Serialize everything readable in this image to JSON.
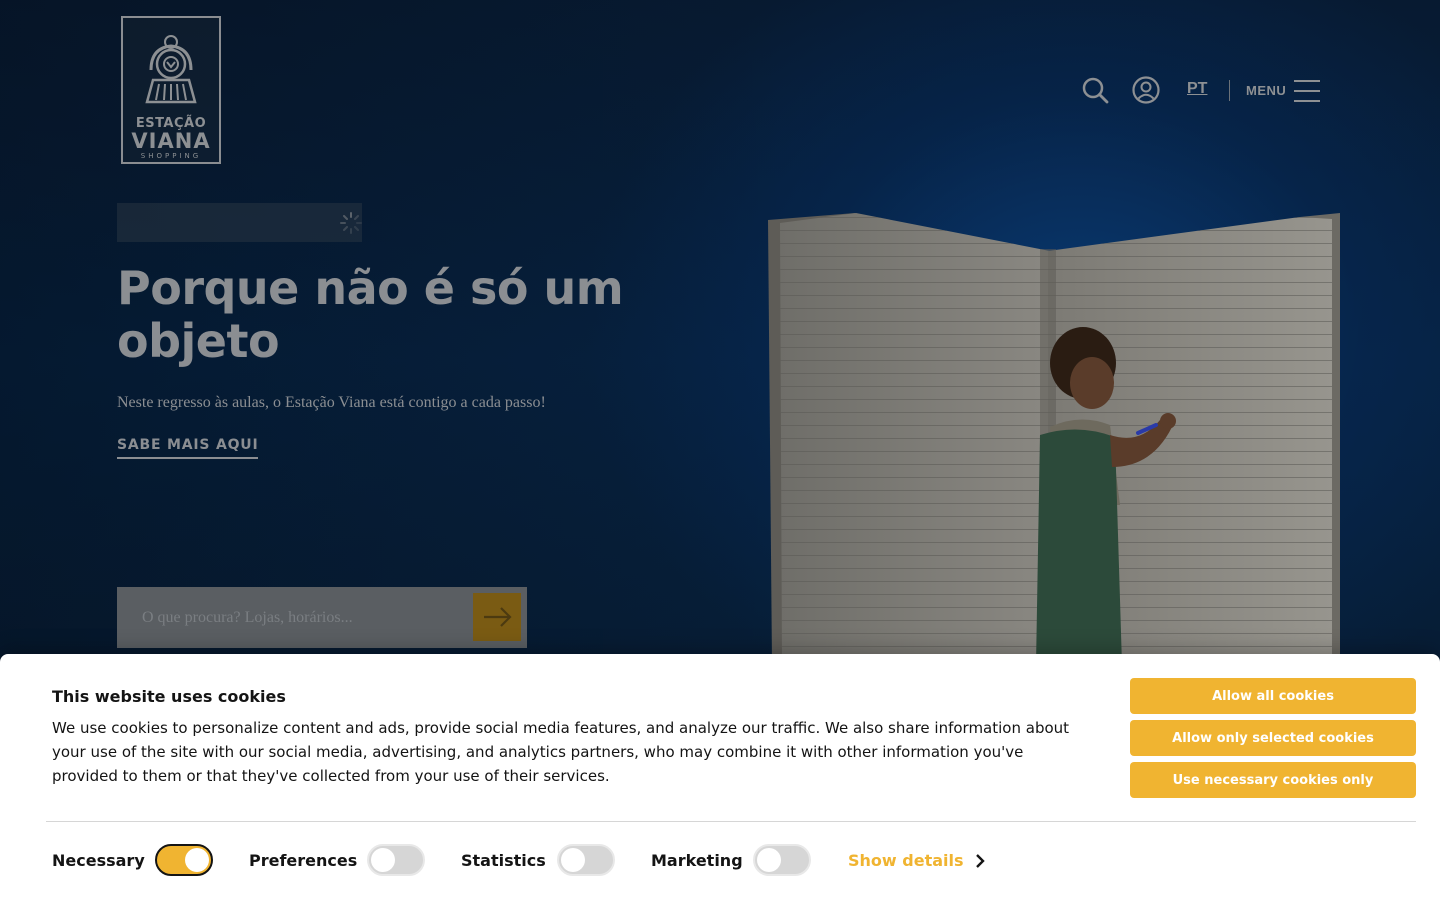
{
  "colors": {
    "accent": "#f0b431",
    "hero_bg": "#06213f",
    "muted_text": "#8b8e92"
  },
  "logo": {
    "line1": "ESTAÇÃO",
    "line2": "VIANA",
    "line3": "SHOPPING"
  },
  "header": {
    "icons": [
      "search-icon",
      "user-account-icon",
      "hamburger-menu-icon"
    ],
    "language": "PT",
    "menu_label": "MENU"
  },
  "hero": {
    "title": "Porque não é só um objeto",
    "subtitle": "Neste regresso às aulas, o Estação Viana está contigo a cada passo!",
    "link_label": "SABE MAIS AQUI"
  },
  "search": {
    "placeholder": "O que procura? Lojas, horários...",
    "value": ""
  },
  "cookie_banner": {
    "title": "This website uses cookies",
    "body": "We use cookies to personalize content and ads, provide social media features, and analyze our traffic. We also share information about your use of the site with our social media, advertising, and analytics partners, who may combine it with other information you've provided to them or that they've collected from your use of their services.",
    "buttons": {
      "allow_all": "Allow all cookies",
      "allow_selected": "Allow only selected cookies",
      "necessary_only": "Use necessary cookies only"
    },
    "categories": [
      {
        "label": "Necessary",
        "enabled": true
      },
      {
        "label": "Preferences",
        "enabled": false
      },
      {
        "label": "Statistics",
        "enabled": false
      },
      {
        "label": "Marketing",
        "enabled": false
      }
    ],
    "show_details": "Show details"
  }
}
